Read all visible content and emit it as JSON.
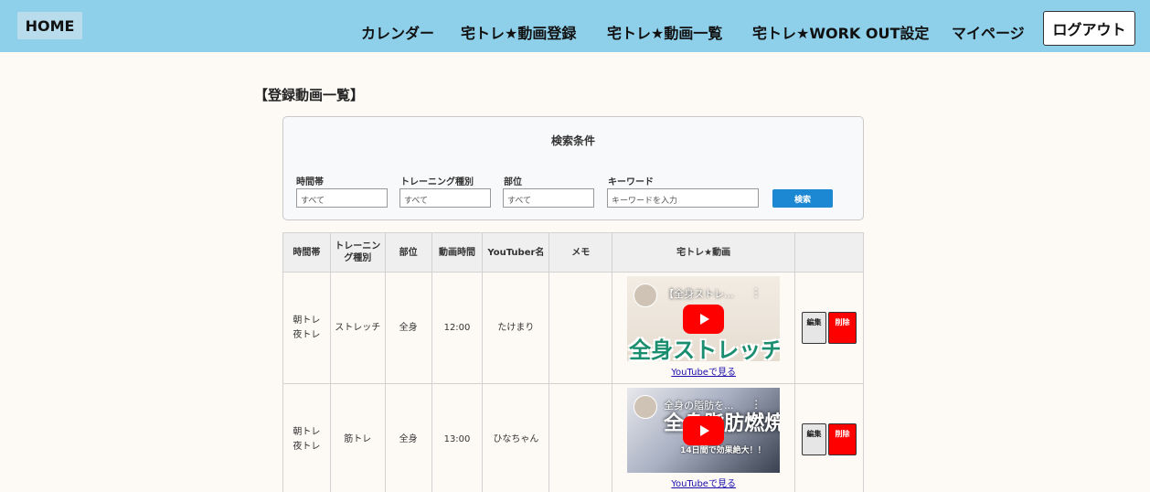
{
  "header": {
    "home_label": "HOME",
    "nav": [
      "カレンダー",
      "宅トレ★動画登録",
      "宅トレ★動画一覧",
      "宅トレ★WORK OUT設定",
      "マイページ"
    ],
    "logout_label": "ログアウト"
  },
  "page": {
    "title": "【登録動画一覧】"
  },
  "search": {
    "title": "検索条件",
    "fields": [
      {
        "label": "時間帯",
        "value": "すべて"
      },
      {
        "label": "トレーニング種別",
        "value": "すべて"
      },
      {
        "label": "部位",
        "value": "すべて"
      }
    ],
    "keyword_label": "キーワード",
    "keyword_placeholder": "キーワードを入力",
    "button_label": "検索"
  },
  "table": {
    "headers": [
      "時間帯",
      "トレーニング種別",
      "部位",
      "動画時間",
      "YouTuber名",
      "メモ",
      "宅トレ★動画",
      ""
    ],
    "rows": [
      {
        "time_slot": [
          "朝トレ",
          "夜トレ"
        ],
        "training_type": "ストレッチ",
        "body_part": "全身",
        "duration": "12:00",
        "youtuber": "たけまり",
        "memo": "",
        "video_title": "【全身ストレ...",
        "thumb_caption": "全身ストレッチ",
        "link_label": "YouTubeで見る",
        "edit_label": "編集",
        "delete_label": "削除"
      },
      {
        "time_slot": [
          "朝トレ",
          "夜トレ"
        ],
        "training_type": "筋トレ",
        "body_part": "全身",
        "duration": "13:00",
        "youtuber": "ひなちゃん",
        "memo": "",
        "video_title": "全身の脂肪を...",
        "thumb_caption": "全身脂肪燃焼",
        "thumb_sub": "14日間で効果絶大！！",
        "link_label": "YouTubeで見る",
        "edit_label": "編集",
        "delete_label": "削除"
      }
    ]
  },
  "colors": {
    "header_bg": "#8ecfea",
    "search_button": "#1c87d3",
    "delete_button": "#ff0000",
    "youtube_red": "#ff0000"
  },
  "icons": {
    "play": "play-icon",
    "more": "more-vert-icon"
  }
}
